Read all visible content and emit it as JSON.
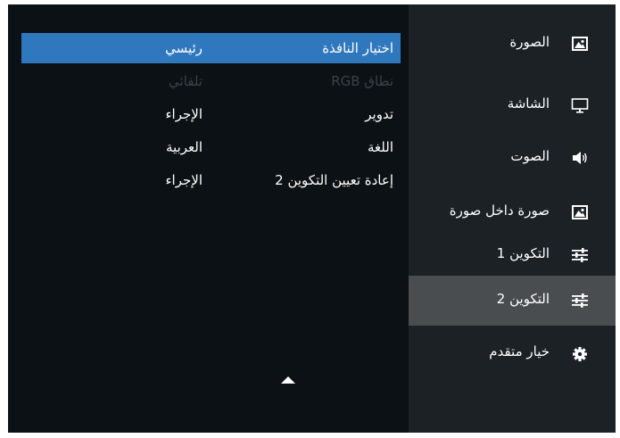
{
  "submenu": {
    "rows": [
      {
        "label": "اختيار النافذة",
        "value": "رئيسي",
        "state": "selected"
      },
      {
        "label": "نطاق RGB",
        "value": "تلقائي",
        "state": "disabled"
      },
      {
        "label": "تدوير",
        "value": "الإجراء",
        "state": "normal"
      },
      {
        "label": "اللغة",
        "value": "العربية",
        "state": "normal"
      },
      {
        "label": "إعادة تعيين التكوين 2",
        "value": "الإجراء",
        "state": "normal"
      }
    ],
    "scroll_icon": "triangle-up-icon"
  },
  "menu": {
    "items": [
      {
        "label": "الصورة",
        "icon": "picture-icon"
      },
      {
        "label": "الشاشة",
        "icon": "monitor-icon"
      },
      {
        "label": "الصوت",
        "icon": "speaker-icon"
      },
      {
        "label": "صورة داخل صورة",
        "icon": "picture-in-picture-icon"
      },
      {
        "label": "التكوين 1",
        "icon": "sliders-icon"
      },
      {
        "label": "التكوين 2",
        "icon": "sliders-icon",
        "active": true
      },
      {
        "label": "خيار متقدم",
        "icon": "gear-icon"
      }
    ]
  },
  "colors": {
    "background": "#0c1115",
    "menu_panel": "#1c2126",
    "selected_row": "#2f78be",
    "active_menu": "#4a4d50"
  }
}
